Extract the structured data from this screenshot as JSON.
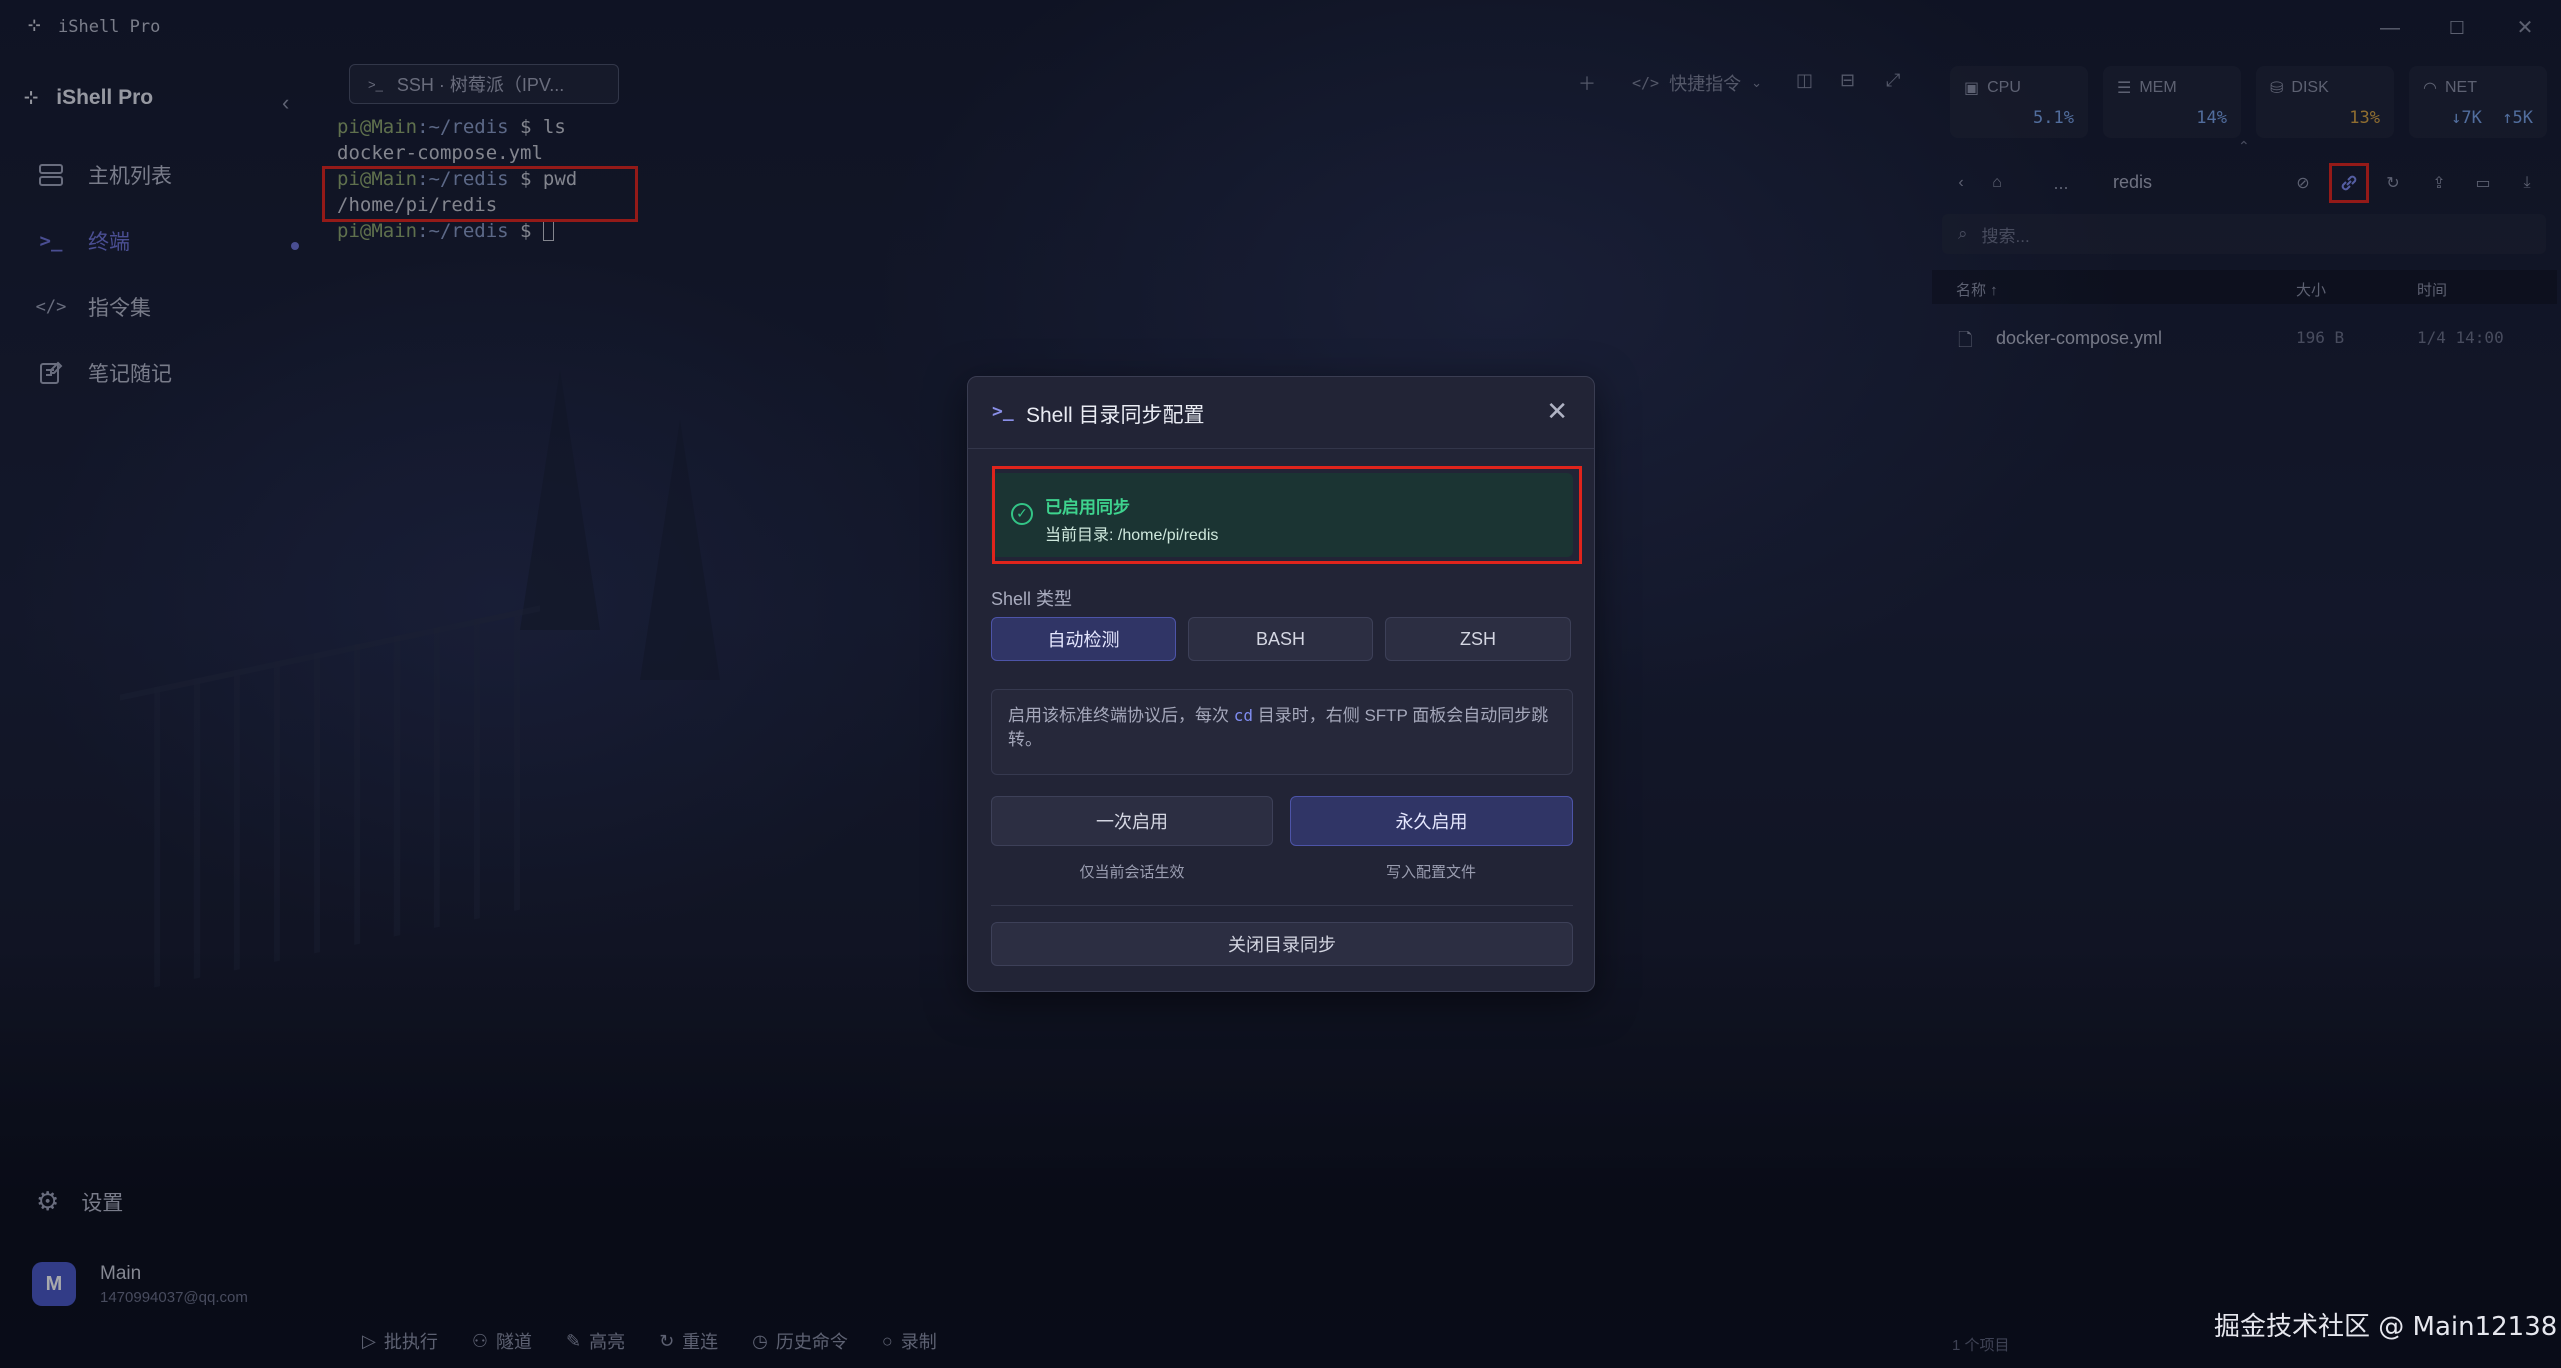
{
  "app": {
    "title": "iShell Pro",
    "brand": "iShell Pro"
  },
  "window_controls": [
    "minimize-icon",
    "maximize-icon",
    "close-icon"
  ],
  "sidebar": {
    "items": [
      {
        "label": "主机列表",
        "icon": "server-icon"
      },
      {
        "label": "终端",
        "icon": "terminal-icon",
        "active": true
      },
      {
        "label": "指令集",
        "icon": "code-icon"
      },
      {
        "label": "笔记随记",
        "icon": "notes-icon"
      }
    ],
    "settings_label": "设置",
    "user": {
      "initial": "M",
      "name": "Main",
      "email": "1470994037@qq.com"
    }
  },
  "terminal": {
    "tab_label": "SSH · 树莓派（IPV...",
    "toolbar": {
      "quick_commands": "快捷指令"
    },
    "lines": [
      {
        "prompt": "pi@Main",
        "path": ":~/redis",
        "cmd": " $ ls"
      },
      {
        "output": "docker-compose.yml"
      },
      {
        "prompt": "pi@Main",
        "path": ":~/redis",
        "cmd": " $ pwd"
      },
      {
        "output": "/home/pi/redis"
      },
      {
        "prompt": "pi@Main",
        "path": ":~/redis",
        "cmd": " $ "
      }
    ],
    "bottom_tools": [
      "批执行",
      "隧道",
      "高亮",
      "重连",
      "历史命令",
      "录制"
    ]
  },
  "stats": [
    {
      "label": "CPU",
      "value": "5.1%",
      "color": "#7aa3e8"
    },
    {
      "label": "MEM",
      "value": "14%",
      "color": "#7aa3e8"
    },
    {
      "label": "DISK",
      "value": "13%",
      "color": "#d9a441"
    },
    {
      "label": "NET",
      "value": "↓7K  ↑5K",
      "color": "#7aa3e8"
    }
  ],
  "file_browser": {
    "breadcrumb_ellipsis": "...",
    "current_dir": "redis",
    "search_placeholder": "搜索...",
    "columns": {
      "name": "名称 ↑",
      "size": "大小",
      "time": "时间"
    },
    "files": [
      {
        "name": "docker-compose.yml",
        "size": "196 B",
        "time": "1/4 14:00"
      }
    ],
    "count": "1 个项目"
  },
  "modal": {
    "title": "Shell 目录同步配置",
    "status_title": "已启用同步",
    "status_dir": "当前目录: /home/pi/redis",
    "shell_type_label": "Shell 类型",
    "shell_types": [
      "自动检测",
      "BASH",
      "ZSH"
    ],
    "info_pre": "启用该标准终端协议后，每次 ",
    "info_code": "cd",
    "info_post": " 目录时，右侧 SFTP 面板会自动同步跳转。",
    "once_label": "一次启用",
    "once_sub": "仅当前会话生效",
    "permanent_label": "永久启用",
    "permanent_sub": "写入配置文件",
    "disable_label": "关闭目录同步"
  },
  "watermark": "掘金技术社区 @ Main12138"
}
